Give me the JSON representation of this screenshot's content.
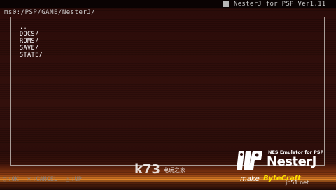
{
  "header": {
    "title": "NesterJ for PSP Ver1.11",
    "path": "ms0:/PSP/GAME/NesterJ/"
  },
  "file_browser": {
    "items": [
      "..",
      "DOCS/",
      "ROMS/",
      "SAVE/",
      "STATE/"
    ]
  },
  "controls": [
    {
      "icon": "circle-button-icon",
      "glyph": "○",
      "label": ":OK"
    },
    {
      "icon": "cross-button-icon",
      "glyph": "✕",
      "label": ":CANCEL"
    },
    {
      "icon": "triangle-button-icon",
      "glyph": "△",
      "label": ":UP"
    }
  ],
  "logo": {
    "subtitle": "NES Emulator for PSP",
    "name": "NesterJ",
    "make_prefix": "make",
    "make_brand": "ByteCraft"
  },
  "watermark": {
    "name": "k73",
    "sub": "电玩之家",
    "badge": "jb51.net"
  },
  "colors": {
    "background": "#2a0b08",
    "text": "#ffffff",
    "accent_orange": "#e98a2a",
    "brand_yellow": "#ffe000"
  }
}
